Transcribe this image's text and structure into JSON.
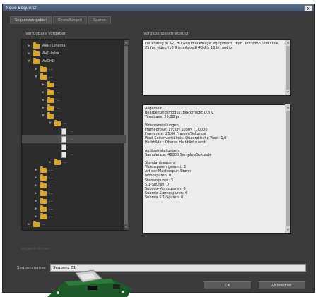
{
  "window": {
    "title": "Neue Sequenz",
    "close_glyph": "x"
  },
  "tabs": [
    {
      "label": "Sequenzvorgaben",
      "active": true
    },
    {
      "label": "Einstellungen",
      "active": false
    },
    {
      "label": "Spuren",
      "active": false
    }
  ],
  "presets_label": "Verfügbare Vorgaben",
  "description_label": "Vorgabenbeschreibung",
  "tree": [
    {
      "depth": 0,
      "expanded": false,
      "type": "folder",
      "label": "ARRI Cinema"
    },
    {
      "depth": 0,
      "expanded": false,
      "type": "folder",
      "label": "AVC-Intra"
    },
    {
      "depth": 0,
      "expanded": true,
      "type": "folder",
      "label": "AVCHD"
    },
    {
      "depth": 1,
      "expanded": false,
      "type": "folder",
      "label": "..."
    },
    {
      "depth": 1,
      "expanded": true,
      "type": "folder",
      "label": "..."
    },
    {
      "depth": 2,
      "expanded": false,
      "type": "folder",
      "label": "..."
    },
    {
      "depth": 2,
      "expanded": false,
      "type": "folder",
      "label": "..."
    },
    {
      "depth": 2,
      "expanded": false,
      "type": "folder",
      "label": "..."
    },
    {
      "depth": 2,
      "expanded": false,
      "type": "folder",
      "label": "..."
    },
    {
      "depth": 2,
      "expanded": true,
      "type": "folder",
      "label": "..."
    },
    {
      "depth": 3,
      "expanded": true,
      "type": "folder",
      "label": "..."
    },
    {
      "depth": 4,
      "expanded": false,
      "type": "file",
      "label": "..."
    },
    {
      "depth": 4,
      "expanded": false,
      "type": "file",
      "label": "...",
      "selected": true
    },
    {
      "depth": 4,
      "expanded": false,
      "type": "file",
      "label": "..."
    },
    {
      "depth": 4,
      "expanded": false,
      "type": "file",
      "label": "..."
    },
    {
      "depth": 3,
      "expanded": false,
      "type": "folder",
      "label": "..."
    },
    {
      "depth": 1,
      "expanded": false,
      "type": "folder",
      "label": "..."
    },
    {
      "depth": 1,
      "expanded": false,
      "type": "folder",
      "label": "..."
    },
    {
      "depth": 1,
      "expanded": false,
      "type": "folder",
      "label": "..."
    },
    {
      "depth": 1,
      "expanded": false,
      "type": "folder",
      "label": "..."
    },
    {
      "depth": 1,
      "expanded": false,
      "type": "folder",
      "label": "..."
    },
    {
      "depth": 1,
      "expanded": false,
      "type": "folder",
      "label": "..."
    },
    {
      "depth": 1,
      "expanded": false,
      "type": "folder",
      "label": "..."
    },
    {
      "depth": 0,
      "expanded": false,
      "type": "folder",
      "label": "..."
    }
  ],
  "description": "For editing in AVCHD with Blackmagic equipment. High Definition 1080 line, 25 fps video (16:9 interlaced) 48kHz 16 bit audio.",
  "info_lines": [
    "Allgemein",
    "Bearbeitungsmodus: Blackmagic D.n.v",
    "Timebase: 25,00fps",
    "",
    "Videoeinstellungen",
    "Framegröße: 1920H 1080V (1,0000)",
    "Framerate: 25,00 Frames/Sekunde",
    "Pixel-Seitenverhältnis: Quadratische Pixel (1,0)",
    "Halbbilder: Oberes Halbbild zuerst",
    "",
    "Audioeinstellungen",
    "Samplerate: 48000 Samples/Sekunde",
    "",
    "Standardsequenz",
    "Videospuren gesamt: 3",
    "Art der Masterspur: Stereo",
    "Monospuren: 0",
    "Stereospuren: 3",
    "5.1-Spuren: 0",
    "Submix-Monospuren: 0",
    "Submix-Stereospuren: 0",
    "Submix 5.1-Spuren: 0"
  ],
  "faint_text": "Vorgabe löschen",
  "sequence_name_label": "Sequenzname:",
  "sequence_name_value": "Sequenz 01",
  "buttons": {
    "ok": "OK",
    "cancel": "Abbrechen"
  }
}
